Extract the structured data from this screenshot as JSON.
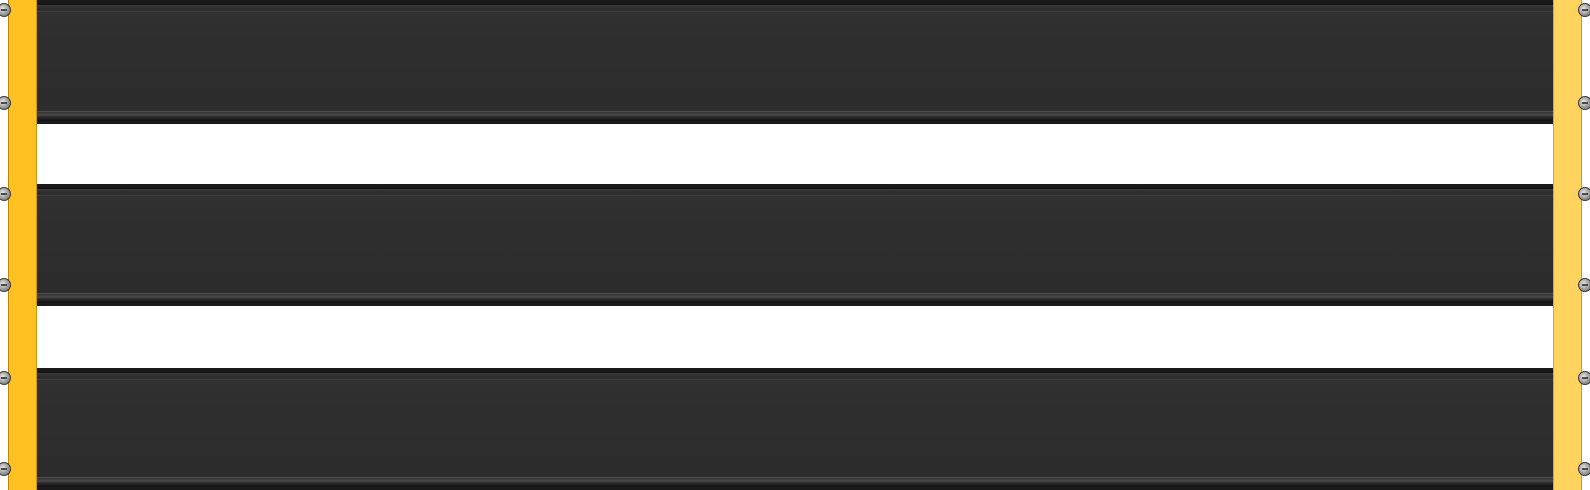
{
  "board": {
    "rail_color_left": "#ffc021",
    "rail_color_right": "#ffd35e",
    "slat_color": "#2e2e2e",
    "gap_color": "#ffffff",
    "slat_count": 3,
    "bolt_icon": "mounting-bolt-icon"
  }
}
